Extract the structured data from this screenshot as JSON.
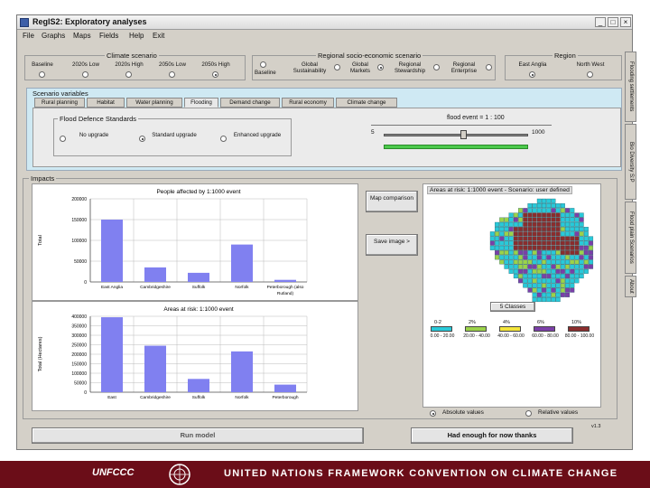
{
  "app": {
    "title": "RegIS2: Exploratory analyses",
    "minimize": "_",
    "maximize": "□",
    "close": "×"
  },
  "menu": [
    "File",
    "Graphs",
    "Maps",
    "Fields",
    "Help",
    "Exit"
  ],
  "climate": {
    "title": "Climate scenario",
    "options": [
      "Baseline",
      "2020s Low",
      "2020s High",
      "2050s Low",
      "2050s High"
    ],
    "selected_index": 4
  },
  "socio": {
    "title": "Regional socio-economic scenario",
    "options": [
      "Baseline",
      "Global Sustainability",
      "Global Markets",
      "Regional Stewardship",
      "Regional Enterprise"
    ],
    "selected_index": 2
  },
  "region": {
    "title": "Region",
    "options": [
      "East Anglia",
      "North West"
    ],
    "selected_index": 0
  },
  "scenario_panel": {
    "title": "Scenario variables",
    "tabs": [
      "Rural planning",
      "Habitat",
      "Water planning",
      "Flooding",
      "Demand change",
      "Rural economy",
      "Climate change"
    ],
    "active_tab_index": 3,
    "sea_defence": {
      "title": "Flood Defence Standards",
      "options": [
        "No upgrade",
        "Standard upgrade",
        "Enhanced upgrade"
      ],
      "selected_index": 1
    },
    "flood_event": {
      "label": "flood event = 1 : 100",
      "min": "5",
      "max": "1000",
      "value_fraction": 0.55
    }
  },
  "side_tabs": [
    "Flooding settlements",
    "Bio Diversity S:P",
    "Flood plain Scenarios",
    "About"
  ],
  "impacts": {
    "title": "Impacts",
    "map_comparison_button": "Map comparison",
    "save_image_button": "Save image >",
    "run_model_button": "Run model",
    "exit_button": "Had enough for now thanks",
    "absolute_label": "Absolute values",
    "relative_label": "Relative values",
    "absolute_selected": true,
    "legend_button": "5 Classes",
    "map_title": "Areas at risk: 1:1000 event - Scenario: user defined",
    "legend": [
      {
        "color": "#29c9d9",
        "pct": "0-2",
        "range": "0.00 - 20.00"
      },
      {
        "color": "#9bd24a",
        "pct": "2%",
        "range": "20.00 - 40.00"
      },
      {
        "color": "#f3e53b",
        "pct": "4%",
        "range": "40.00 - 60.00"
      },
      {
        "color": "#7b3fa8",
        "pct": "6%",
        "range": "60.00 - 80.00"
      },
      {
        "color": "#8a2d2d",
        "pct": "10%",
        "range": "80.00 - 100.00"
      }
    ],
    "version_label": "v1.3"
  },
  "chart_data": [
    {
      "type": "bar",
      "title": "People affected by 1:1000 event",
      "ylabel": "Total",
      "categories": [
        "East Anglia",
        "Cambridgeshire",
        "Suffolk",
        "Norfolk",
        "Peterborough (also Rutland)"
      ],
      "values": [
        150000,
        35000,
        22000,
        90000,
        5000
      ],
      "ylim": [
        0,
        200000
      ],
      "yticks": [
        "0",
        "50000",
        "100000",
        "150000",
        "200000"
      ],
      "color": "#8080f0"
    },
    {
      "type": "bar",
      "title": "Areas at risk: 1:1000 event",
      "ylabel": "Total (Hectares)",
      "categories": [
        "East",
        "Cambridgeshire",
        "Suffolk",
        "Norfolk",
        "Peterborough"
      ],
      "values": [
        395000,
        245000,
        70000,
        215000,
        40000
      ],
      "ylim": [
        0,
        400000
      ],
      "yticks": [
        "0",
        "50000",
        "100000",
        "150000",
        "200000",
        "250000",
        "300000",
        "350000",
        "400000"
      ],
      "color": "#8080f0"
    }
  ],
  "footer": {
    "logo_text": "UNFCCC",
    "banner": "UNITED NATIONS FRAMEWORK CONVENTION ON CLIMATE CHANGE"
  }
}
